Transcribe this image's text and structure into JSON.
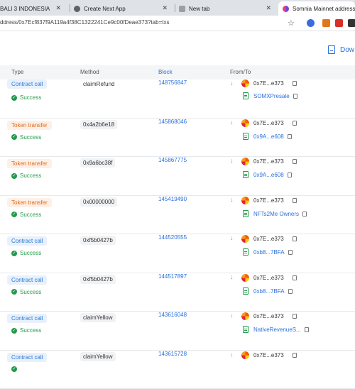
{
  "browser": {
    "tabs": [
      {
        "label": "BALI 3 INDONESIA",
        "active": false
      },
      {
        "label": "Create Next App",
        "active": false
      },
      {
        "label": "New tab",
        "active": false
      },
      {
        "label": "Somnia Mainnet address d",
        "active": true
      }
    ],
    "url": "ddress/0x7Ecf837f9A119a4f38C1322241Ce9c00fDeae373?tab=txs"
  },
  "page": {
    "download_label": "Dow"
  },
  "table": {
    "headers": {
      "type": "Type",
      "method": "Method",
      "block": "Block",
      "from_to": "From/To"
    },
    "rows": [
      {
        "type": "Contract call",
        "type_kind": "call",
        "status": "Success",
        "method": "claimRefund",
        "method_plain": true,
        "block": "148756847",
        "from": "0x7E...e373",
        "to": "SOMXPresale"
      },
      {
        "type": "Token transfer",
        "type_kind": "transfer",
        "status": "Success",
        "method": "0x4a2b6e18",
        "method_plain": false,
        "block": "145868046",
        "from": "0x7E...e373",
        "to": "0x9A...e608"
      },
      {
        "type": "Token transfer",
        "type_kind": "transfer",
        "status": "Success",
        "method": "0x9a6bc38f",
        "method_plain": false,
        "block": "145867775",
        "from": "0x7E...e373",
        "to": "0x9A...e608"
      },
      {
        "type": "Token transfer",
        "type_kind": "transfer",
        "status": "Success",
        "method": "0x00000000",
        "method_plain": false,
        "block": "145419490",
        "from": "0x7E...e373",
        "to": "NFTs2Me Owners"
      },
      {
        "type": "Contract call",
        "type_kind": "call",
        "status": "Success",
        "method": "0xf5b0427b",
        "method_plain": false,
        "block": "144520555",
        "from": "0x7E...e373",
        "to": "0xb8...7BFA"
      },
      {
        "type": "Contract call",
        "type_kind": "call",
        "status": "Success",
        "method": "0xf5b0427b",
        "method_plain": false,
        "block": "144517897",
        "from": "0x7E...e373",
        "to": "0xb8...7BFA"
      },
      {
        "type": "Contract call",
        "type_kind": "call",
        "status": "Success",
        "method": "claimYellow",
        "method_plain": false,
        "block": "143616048",
        "from": "0x7E...e373",
        "to": "NativeRevenueS..."
      },
      {
        "type": "Contract call",
        "type_kind": "call",
        "status": "",
        "method": "claimYellow",
        "method_plain": false,
        "block": "143615728",
        "from": "0x7E...e373",
        "to": ""
      }
    ]
  },
  "colors": {
    "accent": "#2a6fdb",
    "success": "#229a4a",
    "transfer": "#e06a1b"
  }
}
